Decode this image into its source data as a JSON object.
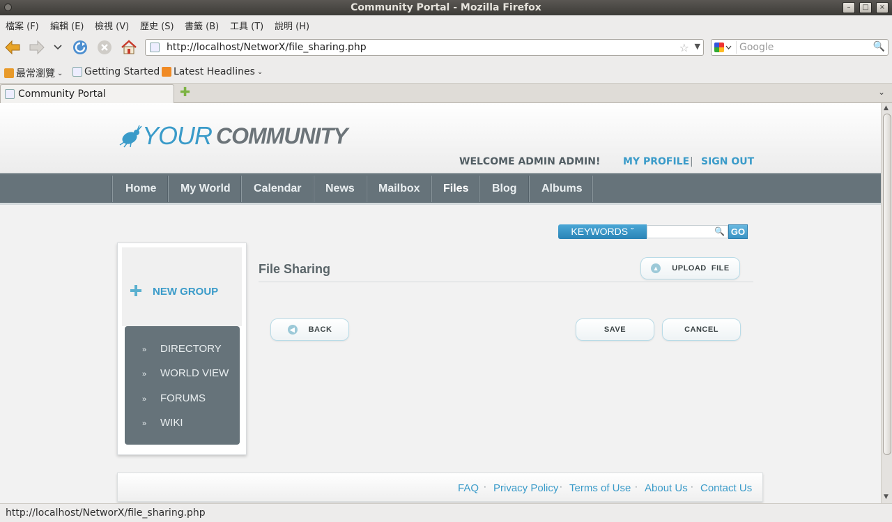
{
  "window": {
    "title": "Community Portal - Mozilla Firefox"
  },
  "menubar": {
    "items": [
      "檔案 (F)",
      "編輯 (E)",
      "檢視 (V)",
      "歷史 (S)",
      "書籤 (B)",
      "工具 (T)",
      "說明 (H)"
    ]
  },
  "navbar": {
    "url": "http://localhost/NetworX/file_sharing.php",
    "search_placeholder": "Google"
  },
  "bookmarks": {
    "items": [
      "最常瀏覽",
      "Getting Started",
      "Latest Headlines"
    ]
  },
  "tabs": [
    {
      "label": "Community Portal"
    }
  ],
  "page": {
    "logo": {
      "part1": "YOUR",
      "part2": "COMMUNITY"
    },
    "welcome": "WELCOME ADMIN ADMIN!",
    "my_profile": "MY PROFILE",
    "separator": "|",
    "sign_out": "SIGN OUT",
    "nav": [
      "Home",
      "My World",
      "Calendar",
      "News",
      "Mailbox",
      "Files",
      "Blog",
      "Albums"
    ],
    "active_nav": "Files",
    "search": {
      "keywords_label": "KEYWORDS ˇ",
      "go_label": "GO"
    },
    "sidebar": {
      "new_group": "NEW GROUP",
      "menu": [
        "DIRECTORY",
        "WORLD VIEW",
        "FORUMS",
        "WIKI"
      ],
      "bullet": "»"
    },
    "main": {
      "title": "File Sharing",
      "upload_label": "UPLOAD  FILE",
      "back_label": "BACK",
      "save_label": "SAVE",
      "cancel_label": "CANCEL"
    },
    "footer": {
      "links": [
        "FAQ",
        "Privacy Policy",
        "Terms of Use",
        "About Us",
        "Contact Us"
      ],
      "dot": "·"
    }
  },
  "statusbar": {
    "text": "http://localhost/NetworX/file_sharing.php"
  },
  "colors": {
    "accent": "#3a9bc9",
    "nav_bg": "#66737a",
    "titlebar": "#3c3b37"
  }
}
